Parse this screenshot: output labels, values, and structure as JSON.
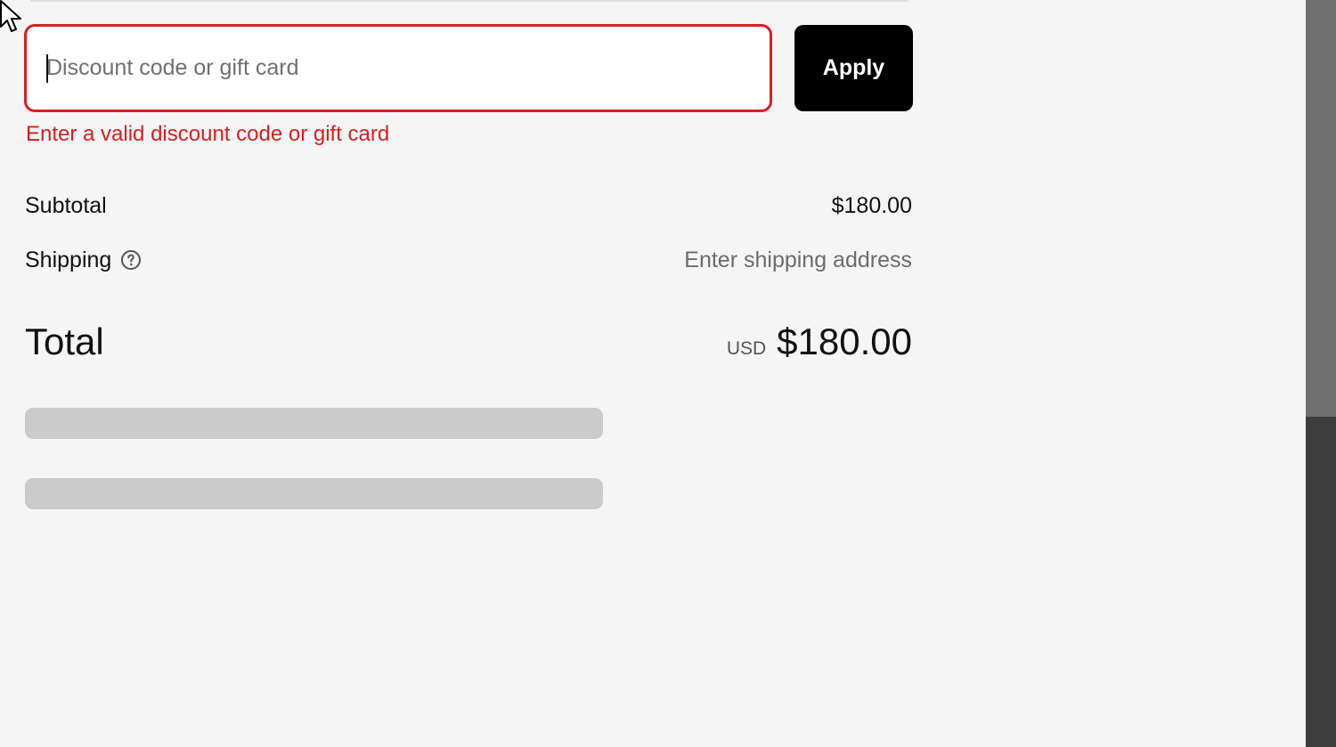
{
  "discount": {
    "placeholder": "Discount code or gift card",
    "value": "",
    "apply_label": "Apply",
    "error": "Enter a valid discount code or gift card"
  },
  "summary": {
    "subtotal_label": "Subtotal",
    "subtotal_value": "$180.00",
    "shipping_label": "Shipping",
    "shipping_value": "Enter shipping address",
    "total_label": "Total",
    "total_currency": "USD",
    "total_value": "$180.00"
  },
  "icons": {
    "shipping_help": "question-circle-icon",
    "cursor": "mouse-pointer-icon"
  },
  "colors": {
    "error": "#d91e1e",
    "button_bg": "#000000",
    "page_bg": "#f5f5f5",
    "skeleton": "#cbcbcb"
  }
}
